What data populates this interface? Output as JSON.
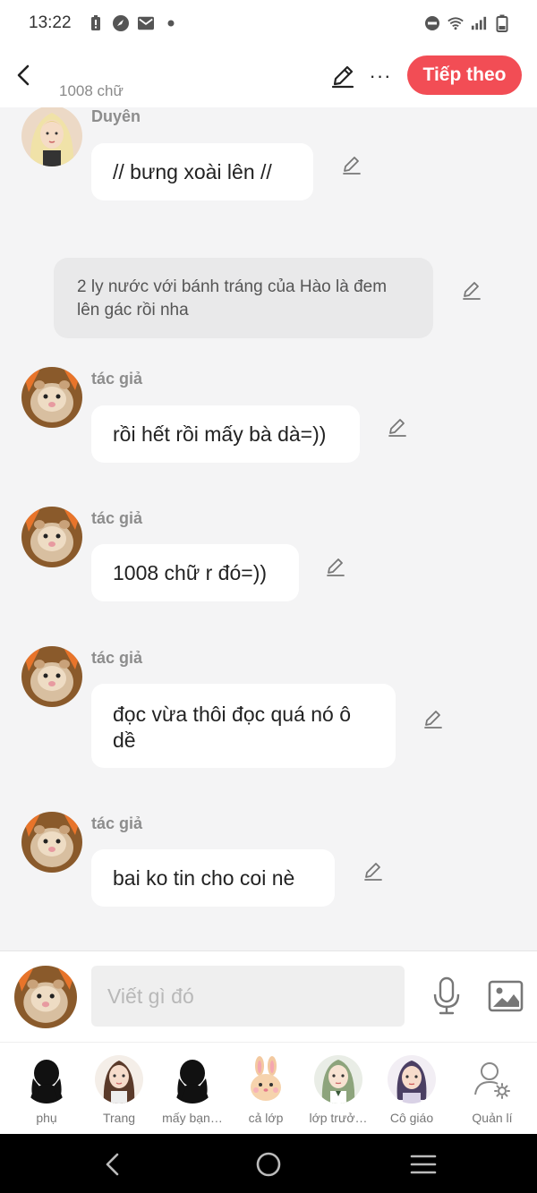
{
  "status_bar": {
    "time": "13:22",
    "left_icons": [
      "battery-alert-icon",
      "compass-icon",
      "mail-icon",
      "dot-icon"
    ],
    "right_icons": [
      "do-not-disturb-icon",
      "wifi-icon",
      "signal-icon",
      "battery-icon"
    ]
  },
  "header": {
    "word_count": "1008 chữ",
    "next_label": "Tiếp theo",
    "more_label": "···"
  },
  "messages": [
    {
      "type": "character",
      "sender": "Duyên",
      "text": "// bưng xoài lên  //",
      "avatar": "blonde-girl"
    },
    {
      "type": "narration",
      "text": "2 ly nước với bánh tráng của Hào là đem lên gác rồi nha"
    },
    {
      "type": "character",
      "sender": "tác giả",
      "text": "rồi hết rồi mấy bà dà=))",
      "avatar": "hamster"
    },
    {
      "type": "character",
      "sender": "tác giả",
      "text": "1008 chữ r đó=))",
      "avatar": "hamster"
    },
    {
      "type": "character",
      "sender": "tác giả",
      "text": "đọc vừa thôi đọc quá nó ô dề",
      "avatar": "hamster"
    },
    {
      "type": "character",
      "sender": "tác giả",
      "text": "bai ko tin cho coi nè",
      "avatar": "hamster"
    }
  ],
  "input": {
    "placeholder": "Viết gì đó"
  },
  "characters": [
    {
      "label": "phụ",
      "icon": "silhouette"
    },
    {
      "label": "Trang",
      "icon": "girl-brown-hair"
    },
    {
      "label": "mấy bạn…",
      "icon": "silhouette"
    },
    {
      "label": "cả lớp",
      "icon": "bunny"
    },
    {
      "label": "lớp trưở…",
      "icon": "girl-green-hair"
    },
    {
      "label": "Cô giáo",
      "icon": "woman-purple-hair"
    },
    {
      "label": "Quản lí",
      "icon": "user-settings-icon"
    }
  ],
  "colors": {
    "accent": "#f24d55",
    "background": "#f4f4f5",
    "bubble": "#ffffff",
    "narration_bg": "#e9e9ea"
  }
}
